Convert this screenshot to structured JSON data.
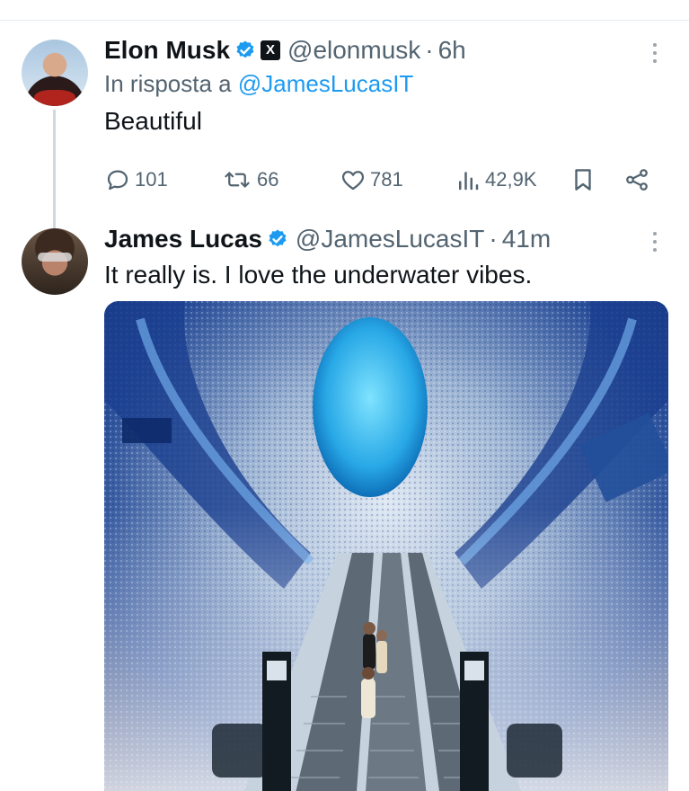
{
  "tweets": [
    {
      "author_name": "Elon Musk",
      "handle": "@elonmusk",
      "dot": "·",
      "time": "6h",
      "reply_prefix": "In risposta a ",
      "reply_handle": "@JamesLucasIT",
      "text": "Beautiful",
      "badges": [
        "verified-badge-icon",
        "x-affiliate-badge-icon"
      ],
      "affiliate_badge_label": "X",
      "actions": {
        "replies": "101",
        "reposts": "66",
        "likes": "781",
        "views": "42,9K"
      }
    },
    {
      "author_name": "James Lucas",
      "handle": "@JamesLucasIT",
      "dot": "·",
      "time": "41m",
      "text": "It really is. I love the underwater vibes.",
      "badges": [
        "verified-badge-icon"
      ],
      "media": "photo of a mosaic-tiled blue subway station with escalators"
    }
  ],
  "colors": {
    "accent": "#1d9bf0",
    "text": "#0f1419",
    "secondary": "#536471",
    "divider": "#cfd9de"
  }
}
